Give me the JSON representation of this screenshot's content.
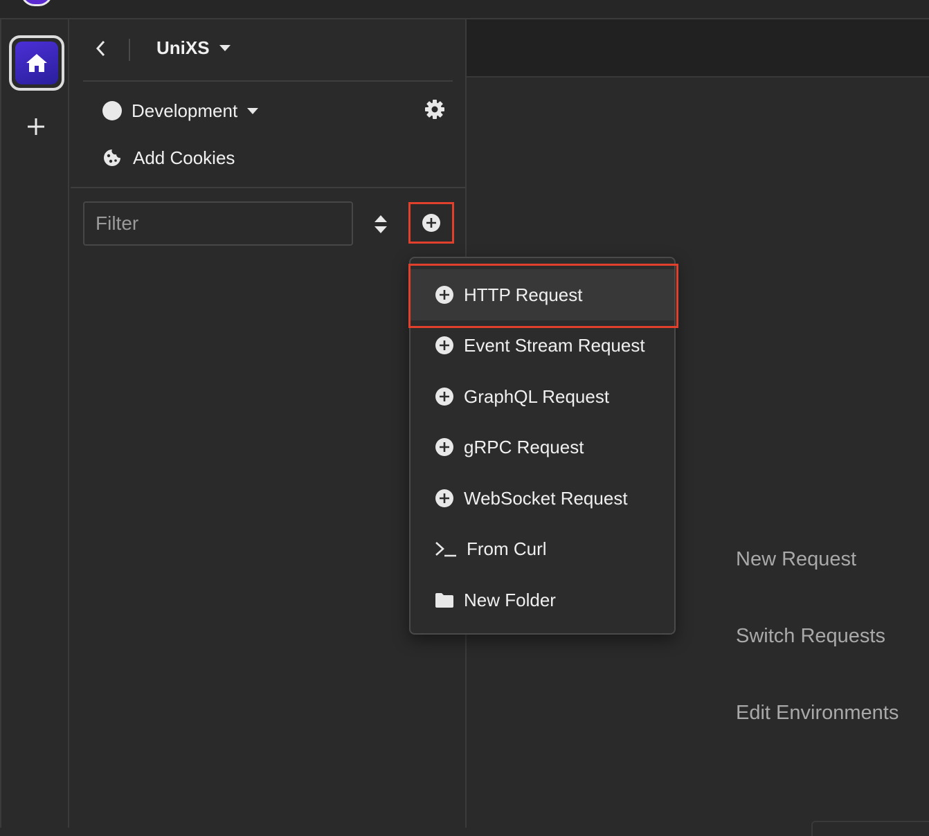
{
  "workspace": {
    "name": "UniXS"
  },
  "environment": {
    "label": "Development"
  },
  "cookies": {
    "label": "Add Cookies"
  },
  "filter": {
    "placeholder": "Filter"
  },
  "menu": {
    "items": [
      {
        "label": "HTTP Request",
        "icon": "plus-circle-icon"
      },
      {
        "label": "Event Stream Request",
        "icon": "plus-circle-icon"
      },
      {
        "label": "GraphQL Request",
        "icon": "plus-circle-icon"
      },
      {
        "label": "gRPC Request",
        "icon": "plus-circle-icon"
      },
      {
        "label": "WebSocket Request",
        "icon": "plus-circle-icon"
      },
      {
        "label": "From Curl",
        "icon": "terminal-icon"
      },
      {
        "label": "New Folder",
        "icon": "folder-icon"
      }
    ]
  },
  "shortcuts": {
    "new_request": "New Request",
    "switch_requests": "Switch Requests",
    "edit_environments": "Edit Environments"
  },
  "colors": {
    "accent": "#4b2fd6",
    "highlight": "#e0402c",
    "background": "#2a2a2a"
  }
}
